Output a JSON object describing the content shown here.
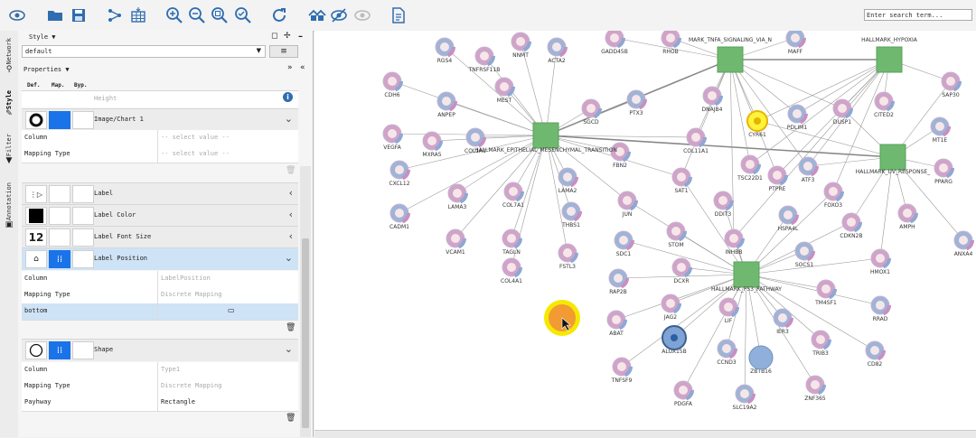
{
  "toolbar": {
    "search_placeholder": "Enter search term..."
  },
  "side_tabs": [
    "Network",
    "Style",
    "Filter",
    "Annotation"
  ],
  "style_panel": {
    "title": "Style ▼",
    "style_name": "default",
    "properties_title": "Properties ▼",
    "col_def": "Def.",
    "col_map": "Map.",
    "col_byp": "Byp.",
    "height_label": "Height",
    "image_chart_label": "Image/Chart 1",
    "image_chart_rows": [
      {
        "key": "Column",
        "value": "-- select value --"
      },
      {
        "key": "Mapping Type",
        "value": "-- select value --"
      }
    ],
    "label_label": "Label",
    "label_color_label": "Label Color",
    "label_font_size_label": "Label Font Size",
    "label_font_size_value": "12",
    "label_position_label": "Label Position",
    "label_position_rows": [
      {
        "key": "Column",
        "value": "LabelPosition"
      },
      {
        "key": "Mapping Type",
        "value": "Discrete Mapping"
      },
      {
        "key": "bottom",
        "value": ""
      }
    ],
    "shape_label": "Shape",
    "shape_rows": [
      {
        "key": "Column",
        "value": "Type1"
      },
      {
        "key": "Mapping Type",
        "value": "Discrete Mapping"
      },
      {
        "key": "Payhway",
        "value": "Rectangle"
      }
    ]
  },
  "network": {
    "hubs": [
      {
        "id": "h1",
        "label": "HALLMARK_EPITHELIAL_MESENCHYMAL_TRANSITION"
      },
      {
        "id": "h2",
        "label": "MARK_TNFA_SIGNALING_VIA_N"
      },
      {
        "id": "h3",
        "label": "HALLMARK_HYPOXIA"
      },
      {
        "id": "h4",
        "label": "HALLMARK_UV_RESPONSE_"
      },
      {
        "id": "h5",
        "label": "HALLMARK_P53_PATHWAY"
      }
    ],
    "genes": [
      "RGS4",
      "NNMT",
      "TNFRSF11B",
      "ACTA2",
      "GADD45B",
      "RHOB",
      "MAFF",
      "SAP30",
      "CDH6",
      "ANPEP",
      "MEST",
      "SGCD",
      "PTX3",
      "DNAJB4",
      "CYR61",
      "PDLIM1",
      "DUSP1",
      "CITED2",
      "MT1E",
      "VEGFA",
      "MXRA5",
      "COL1A1",
      "FBN2",
      "COL11A1",
      "CXCL12",
      "TSC22D1",
      "PTPRE",
      "ATF3",
      "FOXO3",
      "PPARG",
      "CADM1",
      "LAMA3",
      "COL7A1",
      "LAMA2",
      "SAT1",
      "DDIT3",
      "HSPA4L",
      "CDKN2B",
      "AMPH",
      "ANXA4",
      "VCAM1",
      "TAGLN",
      "THBS1",
      "FSTL3",
      "JUN",
      "SDC1",
      "STOM",
      "INHBB",
      "SOCS1",
      "HMOX1",
      "COL4A1",
      "RAP2B",
      "DCXR",
      "TM4SF1",
      "RRAD",
      "JAG2",
      "LIF",
      "IER3",
      "ABAT",
      "ALOX15B",
      "CCND3",
      "ZBTB16",
      "TRIB3",
      "CD82",
      "TNFSF9",
      "PDGFA",
      "SLC19A2",
      "ZNF365"
    ]
  }
}
